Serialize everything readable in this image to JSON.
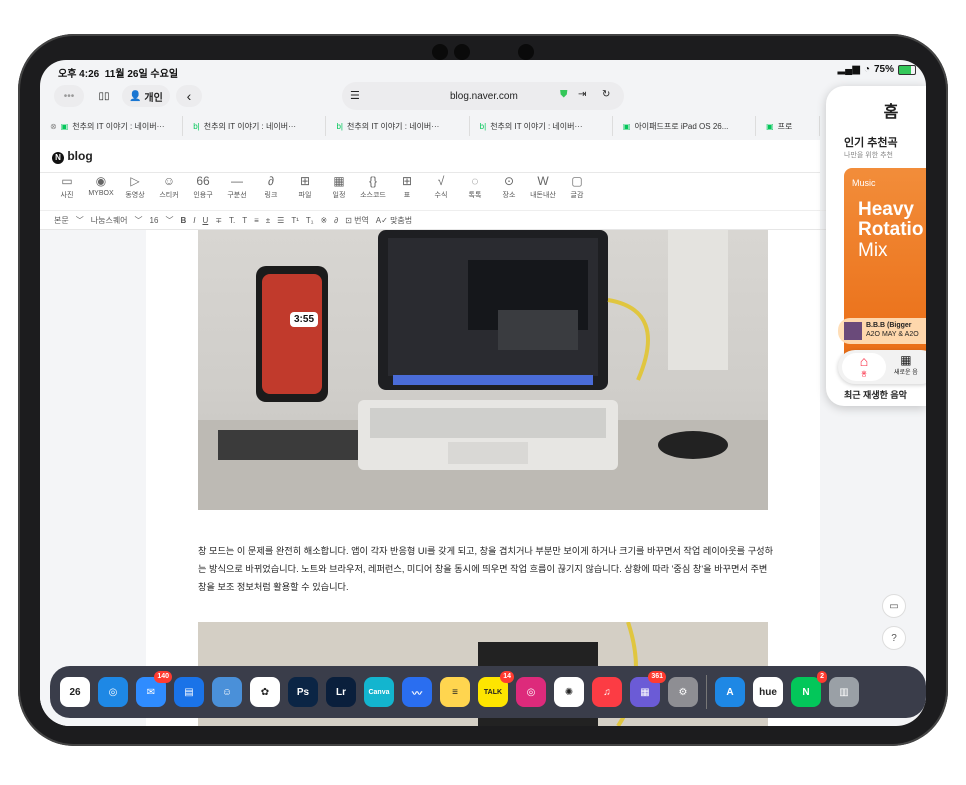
{
  "status": {
    "time": "오후 4:26",
    "date": "11월 26일 수요일",
    "battery": "75%"
  },
  "toolbar": {
    "private_label": "개인",
    "address": "blog.naver.com"
  },
  "tabs": [
    {
      "label": "천추의 IT 이야기 : 네이버···"
    },
    {
      "label": "천추의 IT 이야기 : 네이버···"
    },
    {
      "label": "천추의 IT 이야기 : 네이버···"
    },
    {
      "label": "천추의 IT 이야기 : 네이버···"
    },
    {
      "label": "아이패드프로 iPad OS 26..."
    },
    {
      "label": "프로"
    }
  ],
  "blog": {
    "logo": "blog"
  },
  "tools": [
    {
      "icon": "▭",
      "label": "사진"
    },
    {
      "icon": "◉",
      "label": "MYBOX"
    },
    {
      "icon": "▷",
      "label": "동영상"
    },
    {
      "icon": "☺",
      "label": "스티커"
    },
    {
      "icon": "66",
      "label": "인용구"
    },
    {
      "icon": "—",
      "label": "구분선"
    },
    {
      "icon": "∂",
      "label": "링크"
    },
    {
      "icon": "⊞",
      "label": "파일"
    },
    {
      "icon": "▦",
      "label": "일정"
    },
    {
      "icon": "{}",
      "label": "소스코드"
    },
    {
      "icon": "⊞",
      "label": "표"
    },
    {
      "icon": "√",
      "label": "수식"
    },
    {
      "icon": "◌",
      "label": "톡톡"
    },
    {
      "icon": "⊙",
      "label": "장소"
    },
    {
      "icon": "W",
      "label": "내돈내산"
    },
    {
      "icon": "▢",
      "label": "글감"
    }
  ],
  "format": {
    "style": "본문",
    "font": "나눔스퀘어",
    "size": "16",
    "translate": "번역",
    "spell": "맞춤법"
  },
  "article": {
    "paragraph": "창 모드는 이 문제를 완전히 해소합니다. 앱이 각자 반응형 UI를 갖게 되고, 창을 겹치거나 부분만 보이게 하거나 크기를 바꾸면서 작업 레이아웃를 구성하는 방식으로 바뀌었습니다. 노트와 브라우저, 레퍼런스, 미디어 창을 동시에 띄우면 작업 흐름이 끊기지 않습니다. 상황에 따라 '중심 창'을 바꾸면서 주변 창을 보조 정보처럼 활용할 수 있습니다.",
    "phone_clock": "3:55"
  },
  "floatbar": {
    "label": "글감",
    "bold": "B",
    "italic": "I",
    "underline": "U"
  },
  "music": {
    "home": "홈",
    "section": "인기 추천곡",
    "sub": "나만을 위한 추천",
    "brand": "Music",
    "mix1": "Heavy",
    "mix2": "Rotatio",
    "mix3": "Mix",
    "song": "B.B.B (Bigger",
    "artist": "A2O MAY & A2O",
    "tab_home": "홈",
    "tab_new": "새로운 음",
    "recent": "최근 재생한 음악"
  },
  "dock": [
    {
      "name": "calendar",
      "label": "26",
      "color": "#ffffff",
      "badge": ""
    },
    {
      "name": "safari",
      "label": "◎",
      "color": "#1e88e5",
      "badge": ""
    },
    {
      "name": "mail",
      "label": "✉",
      "color": "#2f8cff",
      "badge": "140"
    },
    {
      "name": "files",
      "label": "▤",
      "color": "#1a73e8",
      "badge": ""
    },
    {
      "name": "finder",
      "label": "☺",
      "color": "#4a90d9",
      "badge": ""
    },
    {
      "name": "photos",
      "label": "✿",
      "color": "#ffffff",
      "badge": ""
    },
    {
      "name": "photoshop",
      "label": "Ps",
      "color": "#0b2545",
      "badge": ""
    },
    {
      "name": "lightroom",
      "label": "Lr",
      "color": "#0a1f3c",
      "badge": ""
    },
    {
      "name": "canva",
      "label": "Canva",
      "color": "#13b5cf",
      "badge": ""
    },
    {
      "name": "freeform",
      "label": "〰",
      "color": "#2a6ef0",
      "badge": ""
    },
    {
      "name": "notes",
      "label": "≡",
      "color": "#ffd54f",
      "badge": ""
    },
    {
      "name": "kakaotalk",
      "label": "TALK",
      "color": "#fee500",
      "badge": "14"
    },
    {
      "name": "instagram",
      "label": "◎",
      "color": "#dd2a7b",
      "badge": ""
    },
    {
      "name": "chatgpt",
      "label": "✺",
      "color": "#ffffff",
      "badge": ""
    },
    {
      "name": "music",
      "label": "♫",
      "color": "#fc3c44",
      "badge": ""
    },
    {
      "name": "app-folder",
      "label": "▦",
      "color": "#6b5bd6",
      "badge": "361"
    },
    {
      "name": "settings",
      "label": "⚙",
      "color": "#8e8e93",
      "badge": ""
    },
    {
      "name": "appstore",
      "label": "A",
      "color": "#1e88e5",
      "badge": ""
    },
    {
      "name": "hue",
      "label": "hue",
      "color": "#ffffff",
      "badge": ""
    },
    {
      "name": "naver",
      "label": "N",
      "color": "#03c75a",
      "badge": "2"
    },
    {
      "name": "app-library",
      "label": "▥",
      "color": "#9aa0a6",
      "badge": ""
    }
  ]
}
